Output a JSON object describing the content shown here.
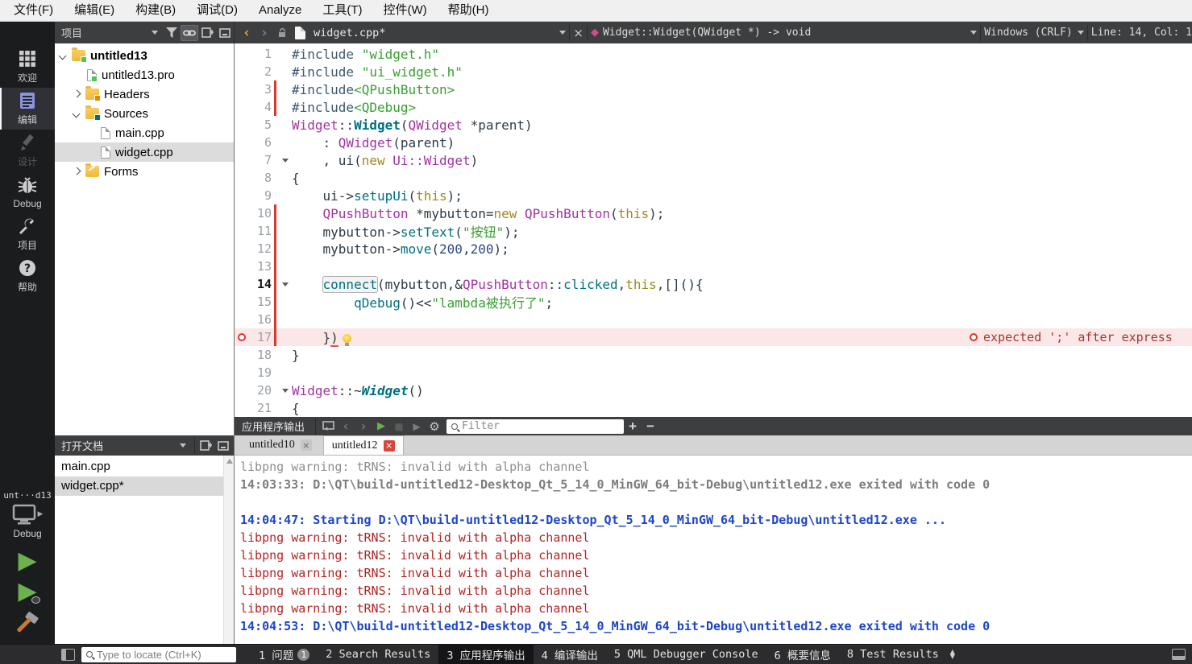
{
  "menu": {
    "items": [
      "文件(F)",
      "编辑(E)",
      "构建(B)",
      "调试(D)",
      "Analyze",
      "工具(T)",
      "控件(W)",
      "帮助(H)"
    ]
  },
  "toolbar": {
    "project_combo": "项目",
    "doc_tab": "widget.cpp*",
    "symbol": "Widget::Widget(QWidget *) -> void",
    "line_ending": "Windows (CRLF)",
    "cursor_pos": "Line: 14, Col: 1"
  },
  "sidebar": {
    "modes": [
      {
        "label": "欢迎",
        "active": false,
        "disabled": false
      },
      {
        "label": "编辑",
        "active": true,
        "disabled": false
      },
      {
        "label": "设计",
        "active": false,
        "disabled": true
      },
      {
        "label": "Debug",
        "active": false,
        "disabled": false
      },
      {
        "label": "项目",
        "active": false,
        "disabled": false
      },
      {
        "label": "帮助",
        "active": false,
        "disabled": false
      }
    ],
    "project_label": "unt···d13",
    "kit_label": "Debug"
  },
  "project_tree": {
    "items": [
      {
        "label": "untitled13",
        "depth": 0,
        "chev": "down",
        "icon": "folder-qt",
        "bold": true,
        "selected": false
      },
      {
        "label": "untitled13.pro",
        "depth": 1,
        "chev": "none",
        "icon": "file-qt",
        "bold": false,
        "selected": false
      },
      {
        "label": "Headers",
        "depth": 1,
        "chev": "right",
        "icon": "folder-h",
        "bold": false,
        "selected": false
      },
      {
        "label": "Sources",
        "depth": 1,
        "chev": "down",
        "icon": "folder-cpp",
        "bold": false,
        "selected": false
      },
      {
        "label": "main.cpp",
        "depth": 2,
        "chev": "none",
        "icon": "file",
        "bold": false,
        "selected": false
      },
      {
        "label": "widget.cpp",
        "depth": 2,
        "chev": "none",
        "icon": "file",
        "bold": false,
        "selected": true
      },
      {
        "label": "Forms",
        "depth": 1,
        "chev": "right",
        "icon": "folder-form",
        "bold": false,
        "selected": false
      }
    ]
  },
  "open_documents": {
    "title": "打开文档",
    "items": [
      {
        "label": "main.cpp",
        "selected": false
      },
      {
        "label": "widget.cpp*",
        "selected": true
      }
    ]
  },
  "editor": {
    "error_annotation": "expected ';' after express",
    "lines": [
      {
        "n": 1,
        "tokens": [
          [
            "pp",
            "#include "
          ],
          [
            "str",
            "\"widget.h\""
          ]
        ]
      },
      {
        "n": 2,
        "tokens": [
          [
            "pp",
            "#include "
          ],
          [
            "str",
            "\"ui_widget.h\""
          ]
        ]
      },
      {
        "n": 3,
        "changed": true,
        "tokens": [
          [
            "pp",
            "#include"
          ],
          [
            "str",
            "<QPushButton>"
          ]
        ]
      },
      {
        "n": 4,
        "changed": true,
        "tokens": [
          [
            "pp",
            "#include"
          ],
          [
            "str",
            "<QDebug>"
          ]
        ]
      },
      {
        "n": 5,
        "tokens": [
          [
            "type",
            "Widget"
          ],
          [
            "pl",
            "::"
          ],
          [
            "fnb",
            "Widget"
          ],
          [
            "pl",
            "("
          ],
          [
            "type",
            "QWidget"
          ],
          [
            "pl",
            " *parent)"
          ]
        ]
      },
      {
        "n": 6,
        "tokens": [
          [
            "pl",
            "    : "
          ],
          [
            "type",
            "QWidget"
          ],
          [
            "pl",
            "(parent)"
          ]
        ]
      },
      {
        "n": 7,
        "fold": true,
        "tokens": [
          [
            "pl",
            "    , ui("
          ],
          [
            "kw",
            "new"
          ],
          [
            "pl",
            " "
          ],
          [
            "type",
            "Ui::Widget"
          ],
          [
            "pl",
            ")"
          ]
        ]
      },
      {
        "n": 8,
        "tokens": [
          [
            "pl",
            "{"
          ]
        ]
      },
      {
        "n": 9,
        "tokens": [
          [
            "pl",
            "    ui->"
          ],
          [
            "fn",
            "setupUi"
          ],
          [
            "pl",
            "("
          ],
          [
            "kw",
            "this"
          ],
          [
            "pl",
            ");"
          ]
        ]
      },
      {
        "n": 10,
        "changed": true,
        "tokens": [
          [
            "pl",
            "    "
          ],
          [
            "type",
            "QPushButton"
          ],
          [
            "pl",
            " *mybutton="
          ],
          [
            "kw",
            "new"
          ],
          [
            "pl",
            " "
          ],
          [
            "type",
            "QPushButton"
          ],
          [
            "pl",
            "("
          ],
          [
            "kw",
            "this"
          ],
          [
            "pl",
            ");"
          ]
        ]
      },
      {
        "n": 11,
        "changed": true,
        "tokens": [
          [
            "pl",
            "    mybutton->"
          ],
          [
            "fn",
            "setText"
          ],
          [
            "pl",
            "("
          ],
          [
            "str",
            "\"按钮\""
          ],
          [
            "pl",
            ");"
          ]
        ]
      },
      {
        "n": 12,
        "changed": true,
        "tokens": [
          [
            "pl",
            "    mybutton->"
          ],
          [
            "fn",
            "move"
          ],
          [
            "pl",
            "("
          ],
          [
            "num",
            "200"
          ],
          [
            "pl",
            ","
          ],
          [
            "num",
            "200"
          ],
          [
            "pl",
            ");"
          ]
        ]
      },
      {
        "n": 13,
        "changed": true,
        "tokens": []
      },
      {
        "n": 14,
        "changed": true,
        "fold": true,
        "current": true,
        "tokens": [
          [
            "pl",
            "    "
          ],
          [
            "box",
            "connect"
          ],
          [
            "pl",
            "(mybutton,&"
          ],
          [
            "type",
            "QPushButton"
          ],
          [
            "pl",
            "::"
          ],
          [
            "fn",
            "clicked"
          ],
          [
            "pl",
            ","
          ],
          [
            "kw",
            "this"
          ],
          [
            "pl",
            ",[](){"
          ]
        ]
      },
      {
        "n": 15,
        "changed": true,
        "tokens": [
          [
            "pl",
            "        "
          ],
          [
            "fn",
            "qDebug"
          ],
          [
            "pl",
            "()<<"
          ],
          [
            "str",
            "\"lambda被执行了\""
          ],
          [
            "pl",
            ";"
          ]
        ]
      },
      {
        "n": 16,
        "changed": true,
        "tokens": []
      },
      {
        "n": 17,
        "changed": true,
        "error": true,
        "bulb": true,
        "tokens": [
          [
            "pl",
            "    }"
          ],
          [
            "err",
            ")"
          ]
        ]
      },
      {
        "n": 18,
        "tokens": [
          [
            "pl",
            "}"
          ]
        ]
      },
      {
        "n": 19,
        "tokens": []
      },
      {
        "n": 20,
        "fold": true,
        "tokens": [
          [
            "type",
            "Widget"
          ],
          [
            "pl",
            "::~"
          ],
          [
            "fnbi",
            "Widget"
          ],
          [
            "pl",
            "()"
          ]
        ]
      },
      {
        "n": 21,
        "tokens": [
          [
            "pl",
            "{"
          ]
        ]
      }
    ]
  },
  "output_pane": {
    "title": "应用程序输出",
    "filter_placeholder": "Filter",
    "tabs": [
      {
        "label": "untitled10",
        "close": "gray",
        "active": false
      },
      {
        "label": "untitled12",
        "close": "red",
        "active": true
      }
    ],
    "lines": [
      {
        "style": "gray",
        "text": "libpng warning: tRNS: invalid with alpha channel"
      },
      {
        "style": "grayb",
        "text": "14:03:33: D:\\QT\\build-untitled12-Desktop_Qt_5_14_0_MinGW_64_bit-Debug\\untitled12.exe exited with code 0"
      },
      {
        "style": "gray",
        "text": ""
      },
      {
        "style": "blueb",
        "text": "14:04:47: Starting D:\\QT\\build-untitled12-Desktop_Qt_5_14_0_MinGW_64_bit-Debug\\untitled12.exe ..."
      },
      {
        "style": "red",
        "text": "libpng warning: tRNS: invalid with alpha channel"
      },
      {
        "style": "red",
        "text": "libpng warning: tRNS: invalid with alpha channel"
      },
      {
        "style": "red",
        "text": "libpng warning: tRNS: invalid with alpha channel"
      },
      {
        "style": "red",
        "text": "libpng warning: tRNS: invalid with alpha channel"
      },
      {
        "style": "red",
        "text": "libpng warning: tRNS: invalid with alpha channel"
      },
      {
        "style": "blueb",
        "text": "14:04:53: D:\\QT\\build-untitled12-Desktop_Qt_5_14_0_MinGW_64_bit-Debug\\untitled12.exe exited with code 0"
      }
    ]
  },
  "status_bar": {
    "locate_placeholder": "Type to locate (Ctrl+K)",
    "panes": [
      {
        "label": "1 问题",
        "badge": "1",
        "active": false
      },
      {
        "label": "2 Search Results",
        "active": false
      },
      {
        "label": "3 应用程序输出",
        "active": true
      },
      {
        "label": "4 编译输出",
        "active": false
      },
      {
        "label": "5 QML Debugger Console",
        "active": false
      },
      {
        "label": "6 概要信息",
        "active": false
      },
      {
        "label": "8 Test Results",
        "active": false
      }
    ]
  },
  "colors": {
    "error_red": "#e0352b",
    "changed_line_red": "#d23b2f",
    "run_green": "#67b346",
    "output_blue": "#1d46c8",
    "output_red": "#b22525",
    "string_green": "#3a9e32",
    "type_purple": "#a233a2",
    "function_teal": "#00707f",
    "keyword_olive": "#9c8a1f",
    "active_mode_icon": "#8a93dd",
    "diamond_pink": "#cf4d8e"
  }
}
